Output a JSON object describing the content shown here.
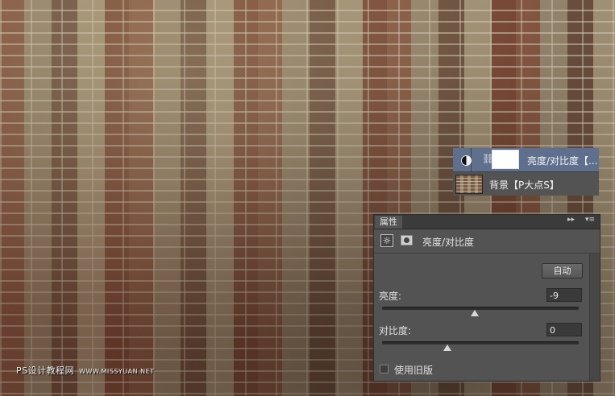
{
  "canvas": {
    "watermark_main": "PS设计教程网",
    "watermark_sub": "WWW.MISSYUAN.NET"
  },
  "layers": [
    {
      "name": "亮度/对比度【...",
      "kind": "adjustment",
      "selected": true
    },
    {
      "name": "背景【P大点S】",
      "kind": "background",
      "selected": false
    }
  ],
  "properties": {
    "tab_label": "属性",
    "collapse_glyph": "▸▸",
    "menu_glyph": "▾≡",
    "sun_glyph": "☼",
    "adjustment_title": "亮度/对比度",
    "auto_label": "自动",
    "brightness": {
      "label": "亮度:",
      "value": "-9",
      "min": -150,
      "max": 150,
      "level": -9
    },
    "contrast": {
      "label": "对比度:",
      "value": "0",
      "min": -50,
      "max": 100,
      "level": 0
    },
    "legacy": {
      "label": "使用旧版",
      "checked": false
    }
  },
  "colors": {
    "panel": "#535353",
    "selected_layer": "#5f6f8e",
    "tabbar": "#3b3b3b"
  }
}
